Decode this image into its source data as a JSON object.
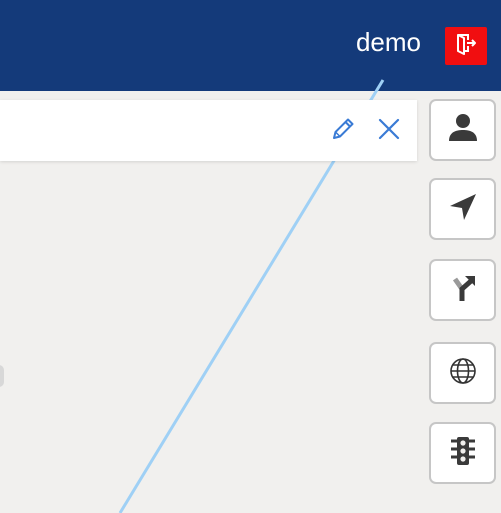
{
  "header": {
    "username": "demo",
    "background_color": "#143a7a",
    "logout_icon": "logout-icon",
    "logout_color": "#f10e10"
  },
  "search_panel": {
    "value": "",
    "placeholder": "",
    "edit_icon": "pencil-icon",
    "clear_icon": "close-icon"
  },
  "map": {
    "background_color": "#f1f0ee",
    "route_color": "#9fd0f5"
  },
  "toolbar": {
    "items": [
      {
        "name": "user-profile",
        "icon": "user-icon"
      },
      {
        "name": "navigate",
        "icon": "navigation-arrow-icon"
      },
      {
        "name": "route-turn",
        "icon": "turn-right-icon"
      },
      {
        "name": "map-language",
        "icon": "globe-icon"
      },
      {
        "name": "traffic",
        "icon": "traffic-light-icon"
      }
    ]
  }
}
